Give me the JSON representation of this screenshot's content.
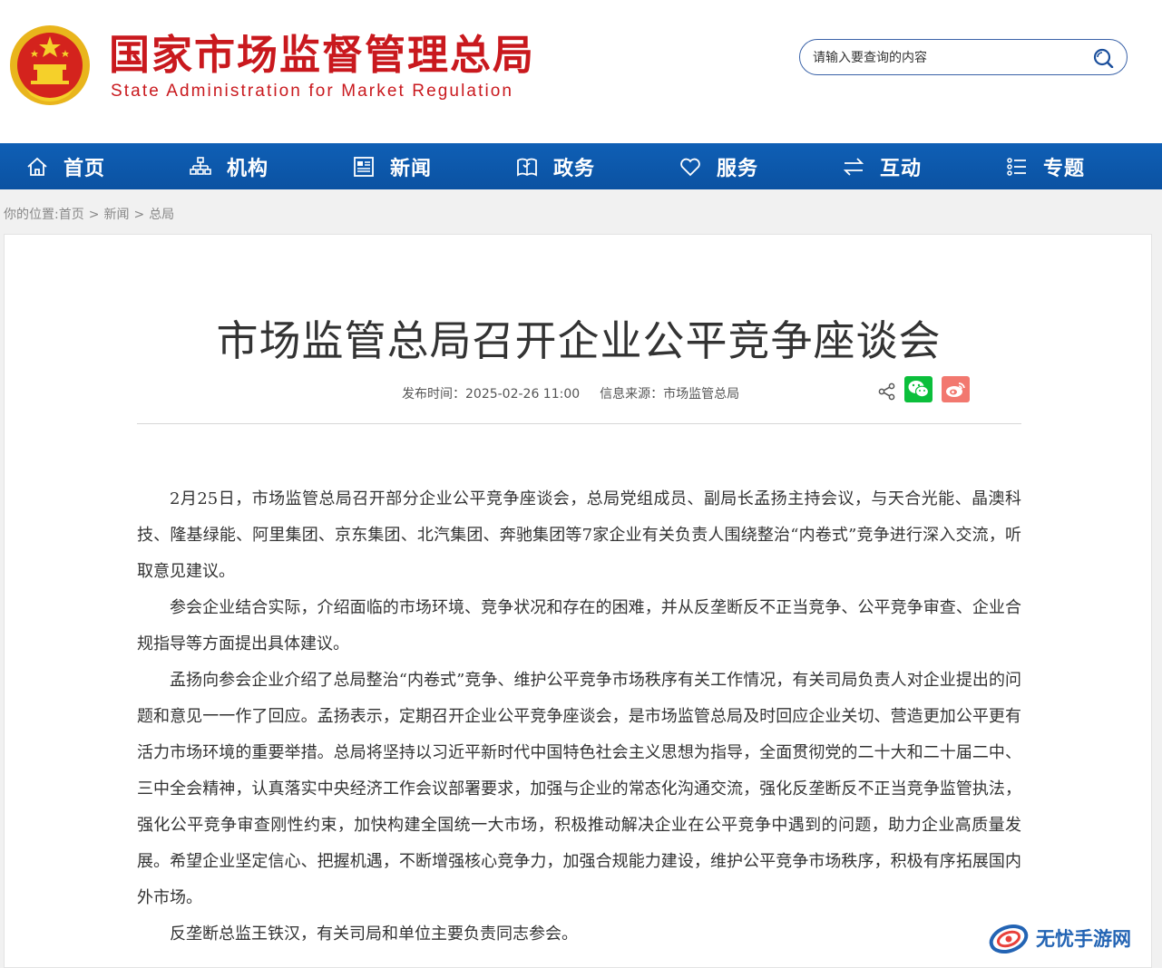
{
  "header": {
    "logo_cn": "国家市场监督管理总局",
    "logo_en": "State Administration for Market Regulation",
    "search_placeholder": "请输入要查询的内容"
  },
  "nav": [
    {
      "label": "首页",
      "icon": "home-icon"
    },
    {
      "label": "机构",
      "icon": "org-chart-icon"
    },
    {
      "label": "新闻",
      "icon": "news-icon"
    },
    {
      "label": "政务",
      "icon": "government-icon"
    },
    {
      "label": "服务",
      "icon": "heart-icon"
    },
    {
      "label": "互动",
      "icon": "exchange-icon"
    },
    {
      "label": "专题",
      "icon": "list-icon"
    }
  ],
  "breadcrumb": {
    "prefix": "你的位置:",
    "items": [
      "首页",
      "新闻",
      "总局"
    ],
    "sep": ">"
  },
  "article": {
    "title": "市场监管总局召开企业公平竞争座谈会",
    "publish_time": "发布时间：2025-02-26 11:00",
    "source": "信息来源：市场监管总局",
    "paragraphs": [
      "2月25日，市场监管总局召开部分企业公平竞争座谈会，总局党组成员、副局长孟扬主持会议，与天合光能、晶澳科技、隆基绿能、阿里集团、京东集团、北汽集团、奔驰集团等7家企业有关负责人围绕整治“内卷式”竞争进行深入交流，听取意见建议。",
      "参会企业结合实际，介绍面临的市场环境、竞争状况和存在的困难，并从反垄断反不正当竞争、公平竞争审查、企业合规指导等方面提出具体建议。",
      "孟扬向参会企业介绍了总局整治“内卷式”竞争、维护公平竞争市场秩序有关工作情况，有关司局负责人对企业提出的问题和意见一一作了回应。孟扬表示，定期召开企业公平竞争座谈会，是市场监管总局及时回应企业关切、营造更加公平更有活力市场环境的重要举措。总局将坚持以习近平新时代中国特色社会主义思想为指导，全面贯彻党的二十大和二十届二中、三中全会精神，认真落实中央经济工作会议部署要求，加强与企业的常态化沟通交流，强化反垄断反不正当竞争监管执法，强化公平竞争审查刚性约束，加快构建全国统一大市场，积极推动解决企业在公平竞争中遇到的问题，助力企业高质量发展。希望企业坚定信心、把握机遇，不断增强核心竞争力，加强合规能力建设，维护公平竞争市场秩序，积极有序拓展国内外市场。",
      "反垄断总监王铁汉，有关司局和单位主要负责同志参会。"
    ]
  },
  "watermark": "无忧手游网",
  "colors": {
    "brand_red": "#c9191e",
    "nav_blue": "#0f5fb5",
    "wechat_green": "#0bbf3b",
    "weibo_red": "#f2786f"
  }
}
